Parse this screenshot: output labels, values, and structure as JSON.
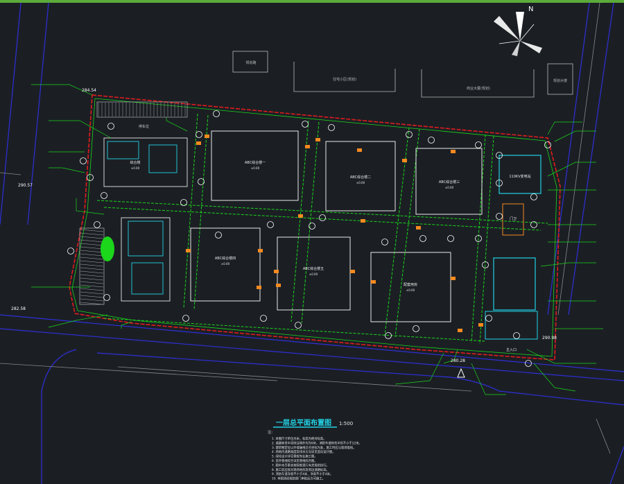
{
  "colors": {
    "background": "#1b1f24",
    "top_bar": "#5cab3a",
    "road_edge": "#2f2fd9",
    "boundary": "#e01c1c",
    "green": "#1bd61b",
    "building": "#e8e8e8",
    "magenta": "#d633d6",
    "cyan": "#22d3e6",
    "orange": "#f58a1f",
    "title": "#22d3e6"
  },
  "north": {
    "label": "N"
  },
  "top_buildings": [
    {
      "label": "规划路"
    },
    {
      "label": "住宅小区(规划)"
    },
    {
      "label": "商业大厦(规划)"
    },
    {
      "label": "规划大楼"
    }
  ],
  "elevations": {
    "top_left": "284.54",
    "left": "290.57",
    "bottom_left": "282.58",
    "bottom_right": "280.28",
    "right": "290.98"
  },
  "buildings": [
    {
      "label": "综合楼",
      "sub": "±0.00"
    },
    {
      "label": "ABC综合楼一",
      "sub": "±0.00"
    },
    {
      "label": "ABC综合楼二",
      "sub": "±0.00"
    },
    {
      "label": "ABC综合楼三",
      "sub": "±0.00"
    },
    {
      "label": "ABC综合楼四",
      "sub": "±0.00"
    },
    {
      "label": "ABC综合楼五",
      "sub": "±0.00"
    },
    {
      "label": "配套用房",
      "sub": "±0.00"
    },
    {
      "label": "门卫",
      "sub": ""
    },
    {
      "label": "110KV变电站",
      "sub": ""
    }
  ],
  "parking_label": "停车位",
  "entrance_label": "主入口",
  "title": {
    "text": "一层总平面布置图",
    "scale": "1:500"
  },
  "notes": {
    "header": "注：",
    "lines": [
      "1. 本图尺寸单位为米，标高为绝对标高。",
      "2. 道路转弯半径除注明外均为9米，消防车道转弯半径不小于12米。",
      "3. 建筑物定位以外墙轴线交点坐标为准，施工时应与现场复核。",
      "4. 场地内道路坡度及排水方向详见竖向设计图。",
      "5. 绿化设计详见景观专业施工图。",
      "6. 室外管线综合详见管线综合图。",
      "7. 图中未尽事宜按国家现行有关规范执行。",
      "8. 施工前应核对现场地形及周边道路标高。",
      "9. 消防车道净宽不小于4米，净高不小于4米。",
      "10. 本图须经规划部门审批后方可施工。"
    ]
  }
}
